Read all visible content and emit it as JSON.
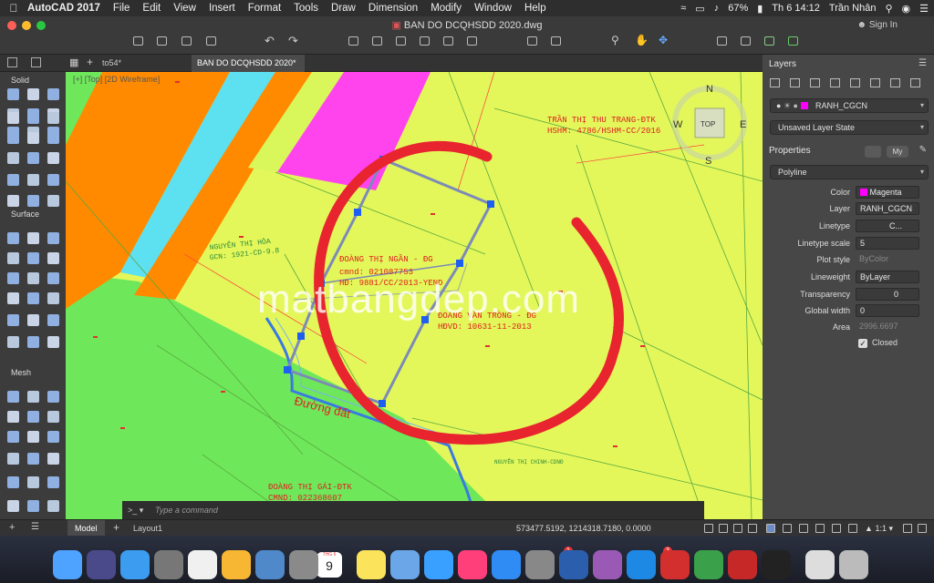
{
  "menubar": {
    "app_name": "AutoCAD 2017",
    "items": [
      "File",
      "Edit",
      "View",
      "Insert",
      "Format",
      "Tools",
      "Draw",
      "Dimension",
      "Modify",
      "Window",
      "Help"
    ],
    "battery": "67%",
    "clock": "Th 6 14:12",
    "user": "Trần Nhân"
  },
  "titlebar": {
    "document_title": "BAN DO DCQHSDD 2020.dwg",
    "sign_in": "Sign In"
  },
  "tabs": {
    "file_tab": "to54*",
    "drawing_tab": "BAN DO DCQHSDD 2020*"
  },
  "viewport": {
    "label": "[+] [Top] [2D Wireframe]",
    "viewcube_top": "TOP",
    "compass": {
      "n": "N",
      "s": "S",
      "e": "E",
      "w": "W"
    },
    "watermark": "matbangdep.com",
    "map_labels": {
      "l1": "TRẦN THỊ THU TRANG-ĐTK",
      "l2": "HSHM: 4786/HSHM-CC/2016",
      "l3": "NGUYỄN THỊ HÒA",
      "l4": "GCN: 1921-CD-9.8",
      "l5": "ĐOÀNG THỊ NGẦN - ĐG",
      "l6": "cmnd: 021087753",
      "l7": "HĐ: 9881/CC/2013-YEND",
      "l8": "ĐOÀNG VĂN TRÒNG - ĐG",
      "l9": "HĐVD: 10631-11-2013",
      "l10": "Đường đất",
      "l11": "ĐOÀNG THỊ GÁI-ĐTK",
      "l12": "CMND: 022368607",
      "l13": "NGUYỄN THỊ CHINH-CDNĐ"
    }
  },
  "left_palette": {
    "sections": [
      "Solid",
      "Surface",
      "Mesh"
    ]
  },
  "command_line": {
    "placeholder": "Type a command"
  },
  "statusbar": {
    "tabs": [
      "Model",
      "Layout1"
    ],
    "coordinates": "573477.5192, 1214318.7180, 0.0000",
    "annotation_scale": "1:1"
  },
  "layers_panel": {
    "title": "Layers",
    "current_layer": "RANH_CGCN",
    "layer_color": "#ff00ff",
    "layer_state": "Unsaved Layer State"
  },
  "properties_panel": {
    "title": "Properties",
    "my_button": "My",
    "object_type": "Polyline",
    "rows": [
      {
        "label": "Color",
        "value": "Magenta"
      },
      {
        "label": "Layer",
        "value": "RANH_CGCN"
      },
      {
        "label": "Linetype",
        "value": "C..."
      },
      {
        "label": "Linetype scale",
        "value": "5"
      },
      {
        "label": "Plot style",
        "value": "ByColor"
      },
      {
        "label": "Lineweight",
        "value": "ByLayer"
      },
      {
        "label": "Transparency",
        "value": "0"
      },
      {
        "label": "Global width",
        "value": "0"
      },
      {
        "label": "Area",
        "value": "2996.6697"
      }
    ],
    "closed_label": "Closed"
  },
  "dock": {
    "calendar_day": "9",
    "calendar_month": "THG 6",
    "badges": {
      "settings": "1",
      "zalo": "3"
    },
    "apps": [
      "finder",
      "siri",
      "safari",
      "launchpad",
      "chrome",
      "photos",
      "preview",
      "image-capture",
      "calendar",
      "notes",
      "mail",
      "messages",
      "itunes",
      "app-store",
      "system-preferences",
      "word",
      "feather",
      "zalo",
      "autocad",
      "coccoc",
      "acrobat",
      "activity-monitor",
      "finder-docs",
      "trash"
    ]
  }
}
